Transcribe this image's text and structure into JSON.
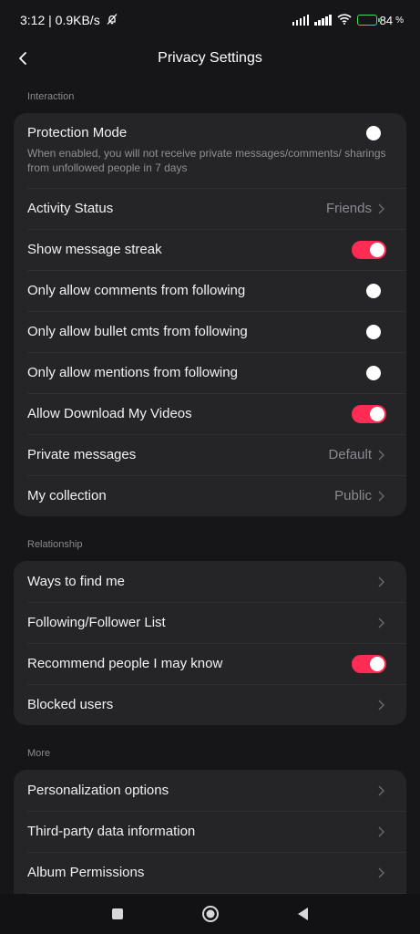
{
  "status_bar": {
    "time_speed": "3:12 | 0.9KB/s",
    "battery": "84"
  },
  "header": {
    "title": "Privacy Settings"
  },
  "sections": {
    "interaction": {
      "label": "Interaction",
      "protection_mode": {
        "label": "Protection Mode",
        "description": "When enabled, you will not receive private messages/comments/ sharings from unfollowed people in 7 days",
        "enabled": false
      },
      "activity_status": {
        "label": "Activity Status",
        "value": "Friends"
      },
      "show_message_streak": {
        "label": "Show message streak",
        "enabled": true
      },
      "comments_following": {
        "label": "Only allow comments from following",
        "enabled": false
      },
      "bullet_following": {
        "label": "Only allow bullet cmts from following",
        "enabled": false
      },
      "mentions_following": {
        "label": "Only allow mentions from following",
        "enabled": false
      },
      "allow_download": {
        "label": "Allow Download My Videos",
        "enabled": true
      },
      "private_messages": {
        "label": "Private messages",
        "value": "Default"
      },
      "my_collection": {
        "label": "My collection",
        "value": "Public"
      }
    },
    "relationship": {
      "label": "Relationship",
      "ways_to_find": {
        "label": "Ways to find me"
      },
      "following_list": {
        "label": "Following/Follower List"
      },
      "recommend_people": {
        "label": "Recommend people I may know",
        "enabled": true
      },
      "blocked_users": {
        "label": "Blocked users"
      }
    },
    "more": {
      "label": "More",
      "personalization": {
        "label": "Personalization options"
      },
      "third_party": {
        "label": "Third-party data information"
      },
      "album_permissions": {
        "label": "Album Permissions"
      }
    }
  },
  "colors": {
    "accent": "#fe2c55",
    "background": "#161618",
    "card": "#252528",
    "battery": "#3ddc5c"
  },
  "icons": {
    "back": "chevron-left-icon",
    "row_arrow": "chevron-right-icon",
    "nav_recents": "square-icon",
    "nav_home": "circle-icon",
    "nav_back": "triangle-back-icon"
  }
}
